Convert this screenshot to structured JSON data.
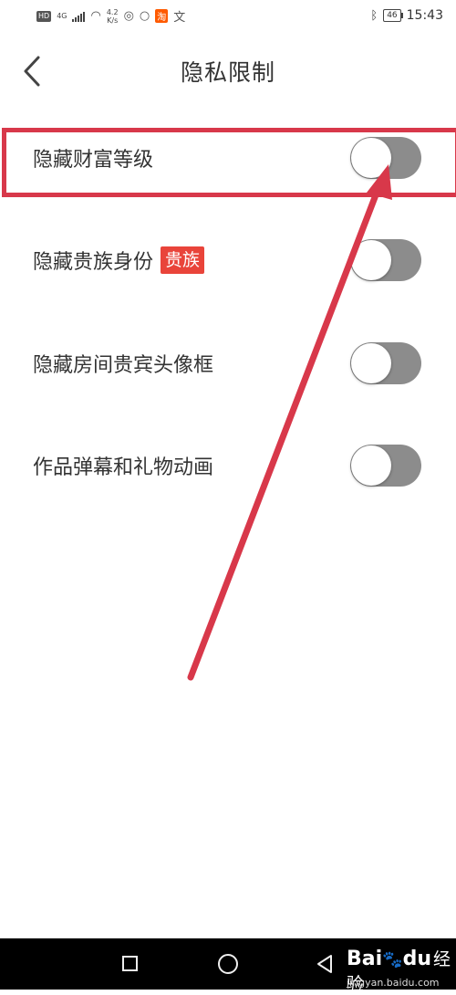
{
  "status_bar": {
    "network_badge": "HD",
    "network_type": "4G",
    "speed_value": "4.2",
    "speed_unit": "K/s",
    "app_icon_tao": "淘",
    "app_icon_wen": "文",
    "battery": "46",
    "time": "15:43",
    "icons": [
      "hd-badge",
      "signal-icon",
      "wifi-icon",
      "notification-icon",
      "circle-icon",
      "taobao-icon",
      "app-icon",
      "bluetooth-icon",
      "battery-icon"
    ]
  },
  "header": {
    "title": "隐私限制",
    "back_icon": "chevron-left-icon"
  },
  "settings": [
    {
      "label": "隐藏财富等级",
      "tag": null,
      "enabled": false
    },
    {
      "label": "隐藏贵族身份",
      "tag": "贵族",
      "enabled": false
    },
    {
      "label": "隐藏房间贵宾头像框",
      "tag": null,
      "enabled": false
    },
    {
      "label": "作品弹幕和礼物动画",
      "tag": null,
      "enabled": false
    }
  ],
  "colors": {
    "annotation": "#d8384a",
    "tag_bg": "#e9443a",
    "toggle_off": "#8c8c8c"
  },
  "nav_bar": {
    "icons": [
      "recent-apps-icon",
      "home-icon",
      "back-icon"
    ]
  },
  "watermark": {
    "logo": "Bai",
    "logo_suffix": "du",
    "label": "经验",
    "url": "jingyan.baidu.com"
  }
}
